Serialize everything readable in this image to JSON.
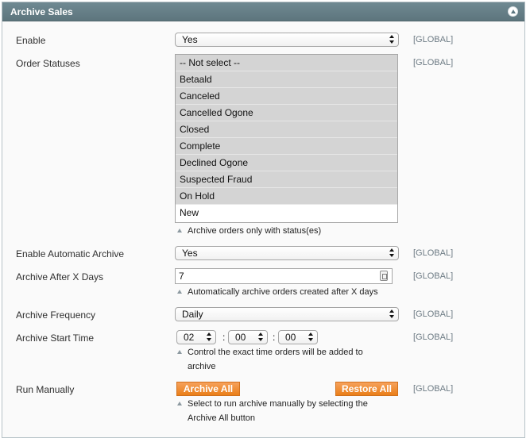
{
  "panel": {
    "title": "Archive Sales"
  },
  "scope_label": "[GLOBAL]",
  "fields": {
    "enable": {
      "label": "Enable",
      "value": "Yes"
    },
    "order_statuses": {
      "label": "Order Statuses",
      "options": [
        "-- Not select --",
        "Betaald",
        "Canceled",
        "Cancelled Ogone",
        "Closed",
        "Complete",
        "Declined Ogone",
        "Suspected Fraud",
        "On Hold",
        "New"
      ],
      "note": "Archive orders only with status(es)"
    },
    "enable_auto": {
      "label": "Enable Automatic Archive",
      "value": "Yes"
    },
    "after_days": {
      "label": "Archive After X Days",
      "value": "7",
      "note": "Automatically archive orders created after X days"
    },
    "frequency": {
      "label": "Archive Frequency",
      "value": "Daily"
    },
    "start_time": {
      "label": "Archive Start Time",
      "hour": "02",
      "minute": "00",
      "second": "00",
      "separator": ":",
      "note": "Control the exact time orders will be added to archive"
    },
    "run_manually": {
      "label": "Run Manually",
      "archive_all": "Archive All",
      "restore_all": "Restore All",
      "note": "Select to run archive manually by selecting the Archive All button"
    }
  },
  "colors": {
    "header": "#647e87",
    "button": "#ec8a2c",
    "selected_option": "#d4d4d4"
  }
}
